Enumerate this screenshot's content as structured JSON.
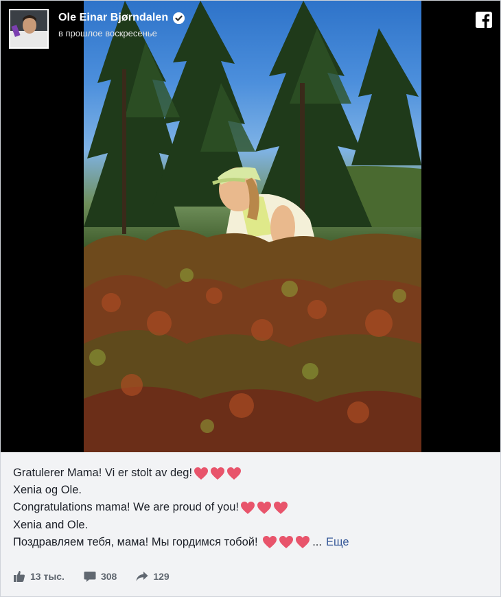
{
  "post": {
    "author": "Ole Einar Bjørndalen",
    "verified": true,
    "timestamp": "в прошлое воскресенье",
    "platform_icon": "facebook-icon",
    "lines": [
      {
        "text": "Gratulerer Mama! Vi er stolt av deg!",
        "hearts": 3
      },
      {
        "text": "Xenia og Ole.",
        "hearts": 0
      },
      {
        "text": "Congratulations mama! We are proud of you!",
        "hearts": 3
      },
      {
        "text": "Xenia and Ole.",
        "hearts": 0
      },
      {
        "text": "Поздравляем тебя, мама! Мы гордимся тобой! ",
        "hearts": 3
      }
    ],
    "ellipsis": "...",
    "more_label": "Еще"
  },
  "stats": {
    "likes": "13 тыс.",
    "comments": "308",
    "shares": "129"
  },
  "colors": {
    "heart": "#e8546b",
    "link": "#365899",
    "text": "#1d2129",
    "muted": "#606770"
  }
}
